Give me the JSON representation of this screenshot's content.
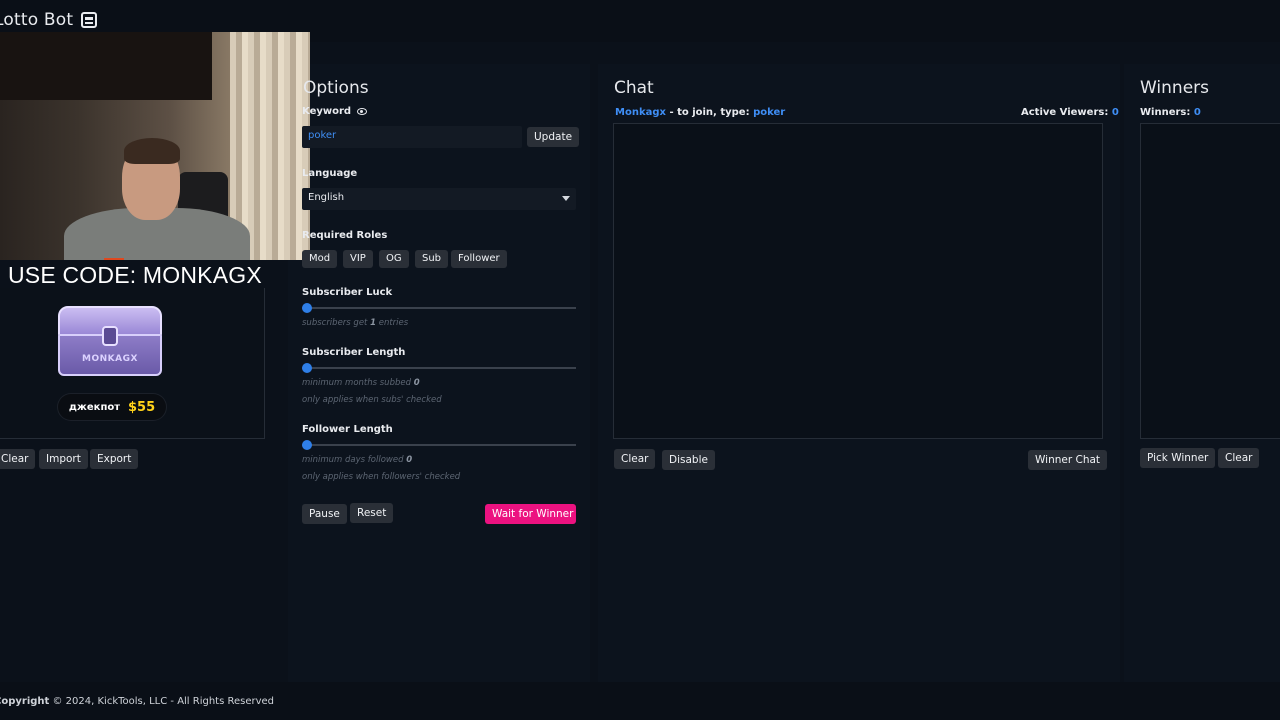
{
  "app": {
    "brand": "Lotto Bot",
    "brand_icon": "robot-icon"
  },
  "overlay": {
    "promo_code": "USE CODE: MONKAGX",
    "chest_label": "MONKAGX",
    "jackpot_label": "джекпот",
    "jackpot_value": "$55"
  },
  "left_actions": {
    "clear": "Clear",
    "import": "Import",
    "export": "Export"
  },
  "options": {
    "title": "Options",
    "keyword_label": "Keyword",
    "keyword_value": "poker",
    "update_button": "Update",
    "language_label": "Language",
    "language_value": "English",
    "roles_label": "Required Roles",
    "roles": [
      "Mod",
      "VIP",
      "OG",
      "Sub",
      "Follower"
    ],
    "sub_luck_label": "Subscriber Luck",
    "sub_luck_prefix": "subscribers get",
    "sub_luck_value": "1",
    "sub_luck_suffix": "entries",
    "sub_luck_level": 0,
    "sub_length_label": "Subscriber Length",
    "sub_length_prefix": "minimum months subbed",
    "sub_length_value": "0",
    "sub_length_note": "only applies when subs' checked",
    "sub_length_level": 0,
    "follower_length_label": "Follower Length",
    "follower_length_prefix": "minimum days followed",
    "follower_length_value": "0",
    "follower_length_note": "only applies when followers' checked",
    "follower_length_level": 0,
    "pause_button": "Pause",
    "reset_button": "Reset",
    "wait_button": "Wait for Winner"
  },
  "chat": {
    "title": "Chat",
    "channel": "Monkagx",
    "join_text": "- to join, type:",
    "join_keyword": "poker",
    "active_viewers_label": "Active Viewers:",
    "active_viewers_value": "0",
    "clear_button": "Clear",
    "disable_button": "Disable",
    "winner_chat_button": "Winner Chat"
  },
  "winners": {
    "title": "Winners",
    "count_label": "Winners:",
    "count_value": "0",
    "pick_button": "Pick Winner",
    "clear_button": "Clear"
  },
  "footer": {
    "copyright_bold": "Copyright",
    "copyright_rest": "© 2024, KickTools, LLC - All Rights Reserved"
  },
  "colors": {
    "accent_blue": "#3f8ef5",
    "accent_pink": "#ec1280",
    "jackpot_yellow": "#ffd21a"
  }
}
